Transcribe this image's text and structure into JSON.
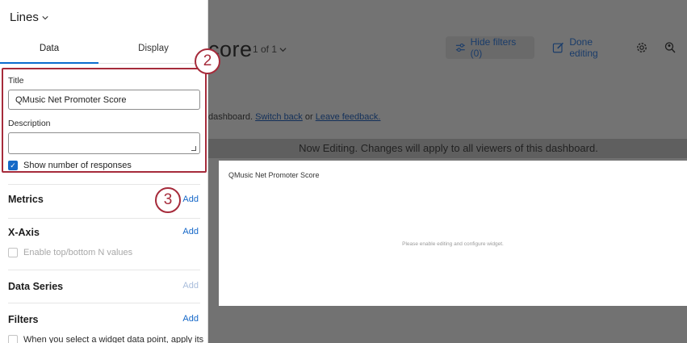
{
  "background": {
    "title_fragment": "core",
    "page_indicator": "1 of 1",
    "hide_filters_label": "Hide filters (0)",
    "done_editing_label": "Done editing",
    "notice_prefix": "dashboard.",
    "switch_back_link": "Switch back",
    "notice_or": "or",
    "leave_feedback_link": "Leave feedback.",
    "editing_banner": "Now Editing. Changes will apply to all viewers of this dashboard.",
    "widget_title": "QMusic Net Promoter Score",
    "widget_empty_message": "Please enable editing and configure widget."
  },
  "panel": {
    "header": "Lines",
    "tabs": [
      {
        "label": "Data",
        "active": true
      },
      {
        "label": "Display",
        "active": false
      }
    ],
    "title_label": "Title",
    "title_value": "QMusic Net Promoter Score",
    "description_label": "Description",
    "description_value": "",
    "show_responses_label": "Show number of responses",
    "show_responses_checked": true,
    "sections": [
      {
        "title": "Metrics",
        "action": "Add",
        "enabled": true
      },
      {
        "title": "X-Axis",
        "action": "Add",
        "enabled": true
      },
      {
        "title": "Data Series",
        "action": "Add",
        "enabled": false
      },
      {
        "title": "Filters",
        "action": "Add",
        "enabled": true
      }
    ],
    "top_bottom_label": "Enable top/bottom N values",
    "filters_note": "When you select a widget data point, apply its"
  },
  "callouts": {
    "step_two": "2",
    "step_three": "3"
  },
  "colors": {
    "accent": "#1467c8",
    "callout": "#a62b3b",
    "overlay": "#727272"
  }
}
